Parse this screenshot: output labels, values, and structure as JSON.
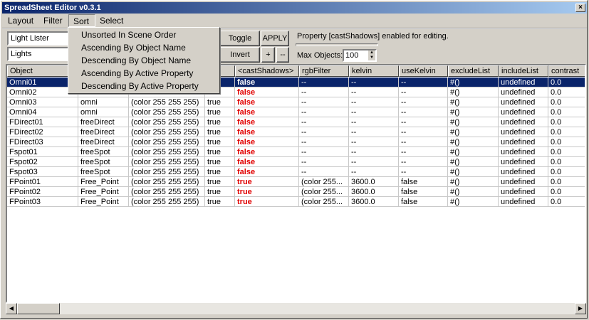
{
  "window": {
    "title": "SpreadSheet Editor v0.3.1",
    "close_label": "×"
  },
  "menu": {
    "items": [
      "Layout",
      "Filter",
      "Sort",
      "Select"
    ]
  },
  "sort_menu": {
    "items": [
      "Unsorted In Scene Order",
      "Ascending By Object Name",
      "Descending By Object Name",
      "Ascending By Active Property",
      "Descending By Active Property"
    ]
  },
  "toolbar": {
    "lister_value": "Light Lister",
    "lights_value": "Lights",
    "toggle_label": "Toggle",
    "apply_label": "APPLY",
    "invert_label": "Invert",
    "plus_label": "+",
    "minus_label": "--",
    "status_text": "Property [castShadows] enabled for editing.",
    "max_objects_label": "Max Objects:",
    "max_objects_value": "100"
  },
  "grid": {
    "columns": [
      "Object",
      "",
      "",
      "",
      "<castShadows>",
      "rgbFilter",
      "kelvin",
      "useKelvin",
      "excludeList",
      "includeList",
      "contrast"
    ],
    "rows": [
      [
        "Omni01",
        "",
        "",
        "",
        "false",
        "--",
        "--",
        "--",
        "#()",
        "undefined",
        "0.0"
      ],
      [
        "Omni02",
        "",
        "",
        "",
        "false",
        "--",
        "--",
        "--",
        "#()",
        "undefined",
        "0.0"
      ],
      [
        "Omni03",
        "omni",
        "(color 255 255 255)",
        "true",
        "false",
        "--",
        "--",
        "--",
        "#()",
        "undefined",
        "0.0"
      ],
      [
        "Omni04",
        "omni",
        "(color 255 255 255)",
        "true",
        "false",
        "--",
        "--",
        "--",
        "#()",
        "undefined",
        "0.0"
      ],
      [
        "FDirect01",
        "freeDirect",
        "(color 255 255 255)",
        "true",
        "false",
        "--",
        "--",
        "--",
        "#()",
        "undefined",
        "0.0"
      ],
      [
        "FDirect02",
        "freeDirect",
        "(color 255 255 255)",
        "true",
        "false",
        "--",
        "--",
        "--",
        "#()",
        "undefined",
        "0.0"
      ],
      [
        "FDirect03",
        "freeDirect",
        "(color 255 255 255)",
        "true",
        "false",
        "--",
        "--",
        "--",
        "#()",
        "undefined",
        "0.0"
      ],
      [
        "Fspot01",
        "freeSpot",
        "(color 255 255 255)",
        "true",
        "false",
        "--",
        "--",
        "--",
        "#()",
        "undefined",
        "0.0"
      ],
      [
        "Fspot02",
        "freeSpot",
        "(color 255 255 255)",
        "true",
        "false",
        "--",
        "--",
        "--",
        "#()",
        "undefined",
        "0.0"
      ],
      [
        "Fspot03",
        "freeSpot",
        "(color 255 255 255)",
        "true",
        "false",
        "--",
        "--",
        "--",
        "#()",
        "undefined",
        "0.0"
      ],
      [
        "FPoint01",
        "Free_Point",
        "(color 255 255 255)",
        "true",
        "true",
        "(color 255...",
        "3600.0",
        "false",
        "#()",
        "undefined",
        "0.0"
      ],
      [
        "FPoint02",
        "Free_Point",
        "(color 255 255 255)",
        "true",
        "true",
        "(color 255...",
        "3600.0",
        "false",
        "#()",
        "undefined",
        "0.0"
      ],
      [
        "FPoint03",
        "Free_Point",
        "(color 255 255 255)",
        "true",
        "true",
        "(color 255...",
        "3600.0",
        "false",
        "#()",
        "undefined",
        "0.0"
      ]
    ],
    "selected_row": 0
  },
  "scrollbar": {
    "left_arrow": "◀",
    "right_arrow": "▶"
  },
  "colors": {
    "selection": "#0a246a",
    "active_value": "#e00000"
  }
}
